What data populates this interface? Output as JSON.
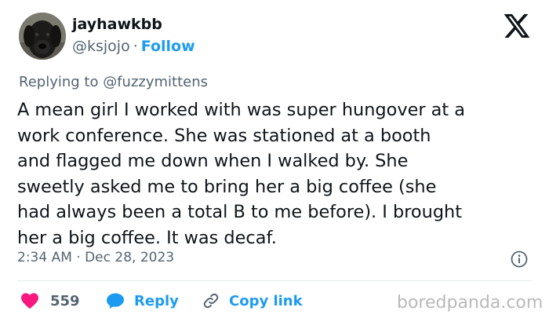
{
  "user": {
    "display_name": "jayhawkbb",
    "handle": "@ksjojo",
    "separator": "·",
    "follow_label": "Follow",
    "avatar_icon": "dog-avatar"
  },
  "reply_context": {
    "prefix": "Replying to",
    "mention": "@fuzzymittens"
  },
  "tweet": {
    "lines": [
      "A mean girl I worked with was super hungover at a",
      "work conference. She was stationed at a booth",
      "and flagged me down when I walked by. She",
      "sweetly asked me to bring her a big coffee (she",
      "had always been a total B to me before). I brought",
      "her a big coffee. It was decaf."
    ]
  },
  "meta": {
    "timestamp": "2:34 AM · Dec 28, 2023",
    "info_icon": "info-icon"
  },
  "actions": {
    "like_count": "559",
    "reply_label": "Reply",
    "copy_label": "Copy link"
  },
  "watermark": "boredpanda.com",
  "colors": {
    "accent": "#1d9bf0",
    "like": "#f91880",
    "text": "#0f1419",
    "muted": "#536471"
  }
}
